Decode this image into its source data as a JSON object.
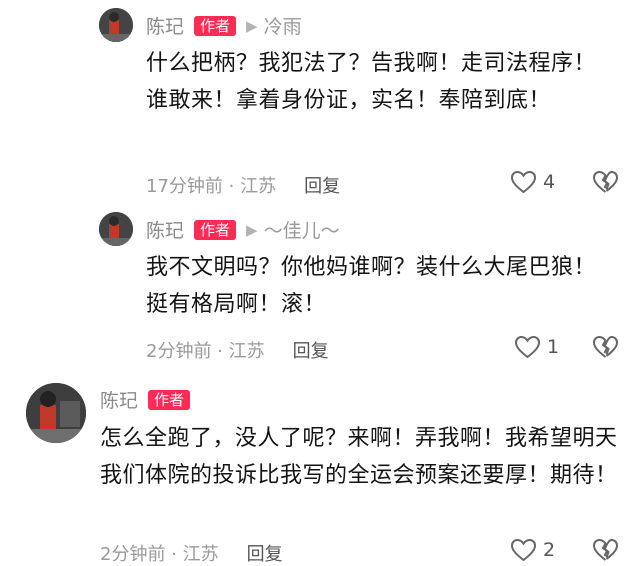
{
  "comments": [
    {
      "author": "陈玘",
      "badge": "作者",
      "reply_to": "冷雨",
      "text": "什么把柄？我犯法了？告我啊！走司法程序！谁敢来！拿着身份证，实名！奉陪到底！",
      "time": "17分钟前 · 江苏",
      "reply_label": "回复",
      "likes": "4"
    },
    {
      "author": "陈玘",
      "badge": "作者",
      "reply_to": "～佳儿～",
      "text": "我不文明吗？你他妈谁啊？装什么大尾巴狼！挺有格局啊！滚！",
      "time": "2分钟前 · 江苏",
      "reply_label": "回复",
      "likes": "1"
    },
    {
      "author": "陈玘",
      "badge": "作者",
      "text": "怎么全跑了，没人了呢？来啊！弄我啊！我希望明天我们体院的投诉比我写的全运会预案还要厚！期待！",
      "time": "2分钟前 · 江苏",
      "reply_label": "回复",
      "likes": "2"
    }
  ],
  "icons": {
    "reply_arrow": "play-triangle-icon",
    "like": "heart-outline-icon",
    "dislike": "broken-heart-icon"
  }
}
